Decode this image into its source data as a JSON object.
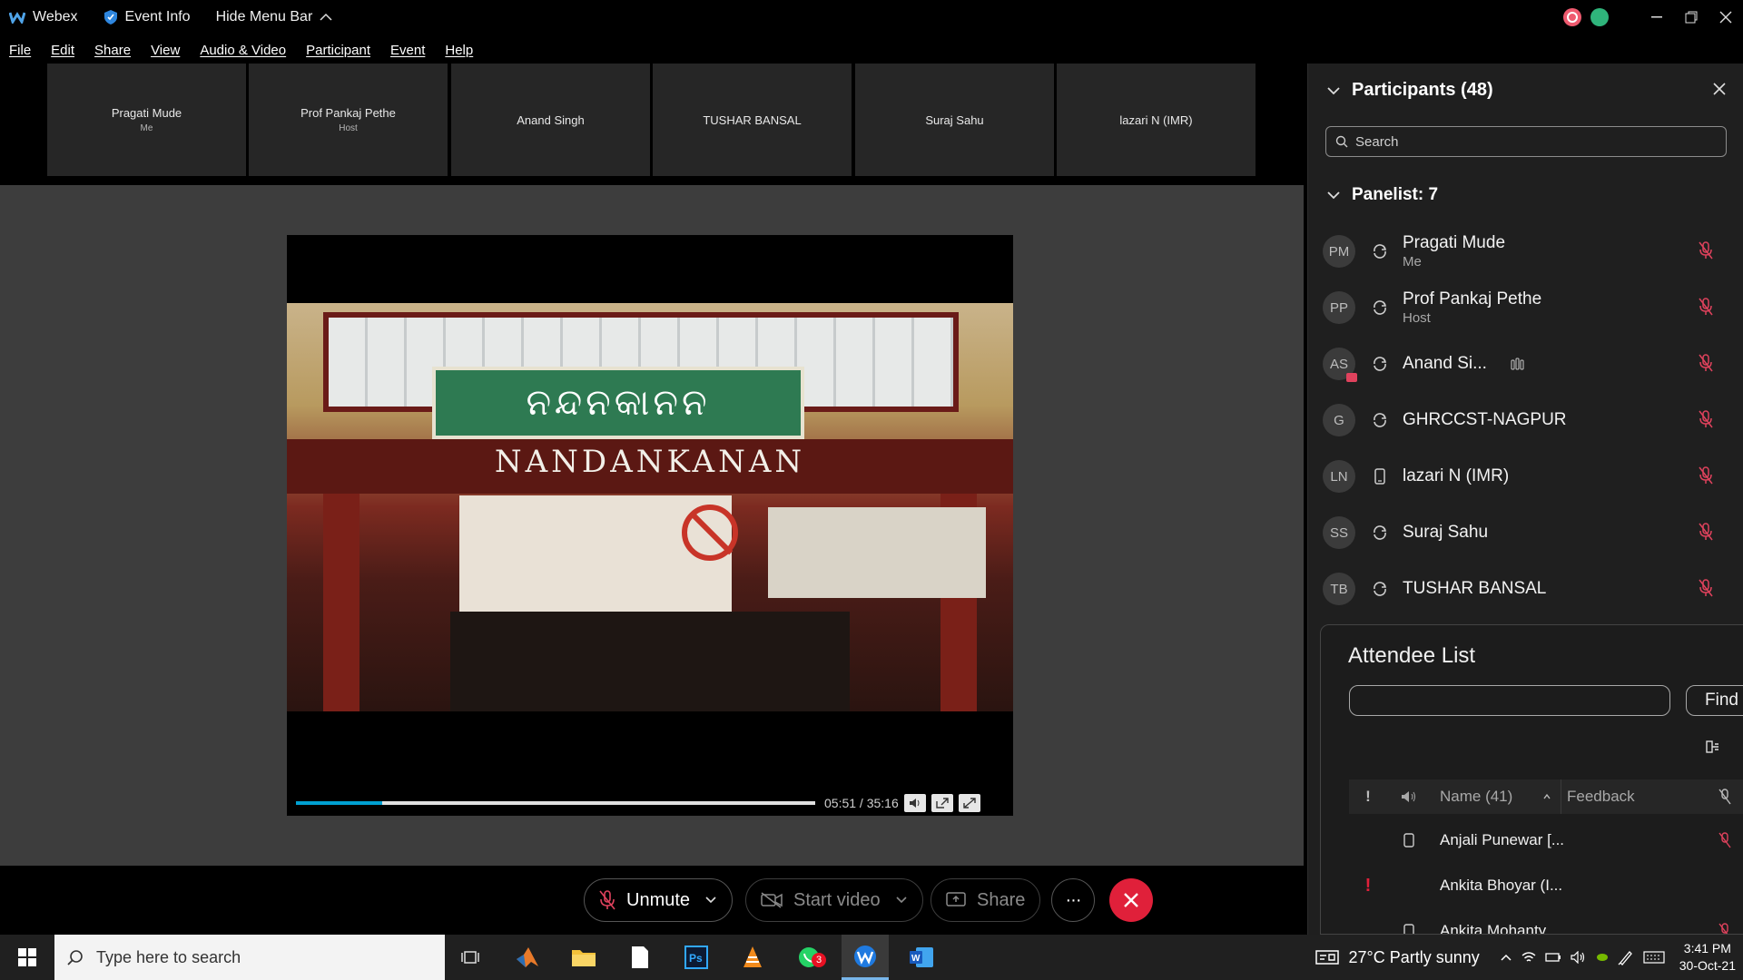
{
  "app": {
    "name": "Webex",
    "event_info": "Event Info",
    "hide_menu_bar": "Hide Menu Bar"
  },
  "menu": [
    "File",
    "Edit",
    "Share",
    "View",
    "Audio & Video",
    "Participant",
    "Event",
    "Help"
  ],
  "thumbnails": [
    {
      "name": "Pragati Mude",
      "role": "Me"
    },
    {
      "name": "Prof Pankaj Pethe",
      "role": "Host"
    },
    {
      "name": "Anand Singh",
      "role": ""
    },
    {
      "name": "TUSHAR BANSAL",
      "role": ""
    },
    {
      "name": "Suraj Sahu",
      "role": ""
    },
    {
      "name": "lazari N (IMR)",
      "role": ""
    }
  ],
  "video": {
    "sign_oriya": "ନନ୍ଦନକାନନ",
    "sign_banner": "NANDANKANAN",
    "time": "05:51 / 35:16",
    "progress": 0.166
  },
  "controls": {
    "unmute": "Unmute",
    "start_video": "Start video",
    "share": "Share",
    "more": "···"
  },
  "participants": {
    "header": "Participants (48)",
    "search_placeholder": "Search",
    "panelist_header": "Panelist: 7",
    "list": [
      {
        "initials": "PM",
        "name": "Pragati Mude",
        "role": "Me",
        "device": "sync"
      },
      {
        "initials": "PP",
        "name": "Prof Pankaj Pethe",
        "role": "Host",
        "device": "sync"
      },
      {
        "initials": "AS",
        "name": "Anand Si...",
        "role": "",
        "device": "sync"
      },
      {
        "initials": "G",
        "name": "GHRCCST-NAGPUR",
        "role": "",
        "device": "sync"
      },
      {
        "initials": "LN",
        "name": "lazari N (IMR)",
        "role": "",
        "device": "phone"
      },
      {
        "initials": "SS",
        "name": "Suraj Sahu",
        "role": "",
        "device": "sync"
      },
      {
        "initials": "TB",
        "name": "TUSHAR BANSAL",
        "role": "",
        "device": "sync"
      }
    ]
  },
  "attendees": {
    "title": "Attendee List",
    "find": "Find",
    "col_alert": "!",
    "col_name": "Name (41)",
    "col_feedback": "Feedback",
    "rows": [
      {
        "alert": "",
        "name": "Anjali Punewar [..."
      },
      {
        "alert": "!",
        "name": "Ankita Bhoyar (I..."
      },
      {
        "alert": "",
        "name": "Ankita Mohanty"
      }
    ]
  },
  "taskbar": {
    "search_placeholder": "Type here to search",
    "whatsapp_badge": "3",
    "weather": "27°C  Partly sunny",
    "time": "3:41 PM",
    "date": "30-Oct-21"
  },
  "colors": {
    "leave_button": "#e0203a",
    "accent": "#00a0d1",
    "muted_icon": "#e0425d"
  }
}
